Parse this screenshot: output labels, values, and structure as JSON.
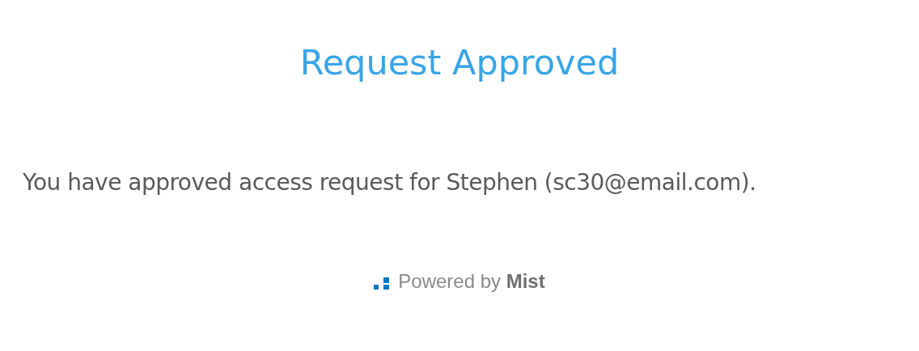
{
  "title": "Request Approved",
  "message": "You have approved access request for Stephen (sc30@email.com).",
  "footer": {
    "text": "Powered by **Mist**"
  }
}
